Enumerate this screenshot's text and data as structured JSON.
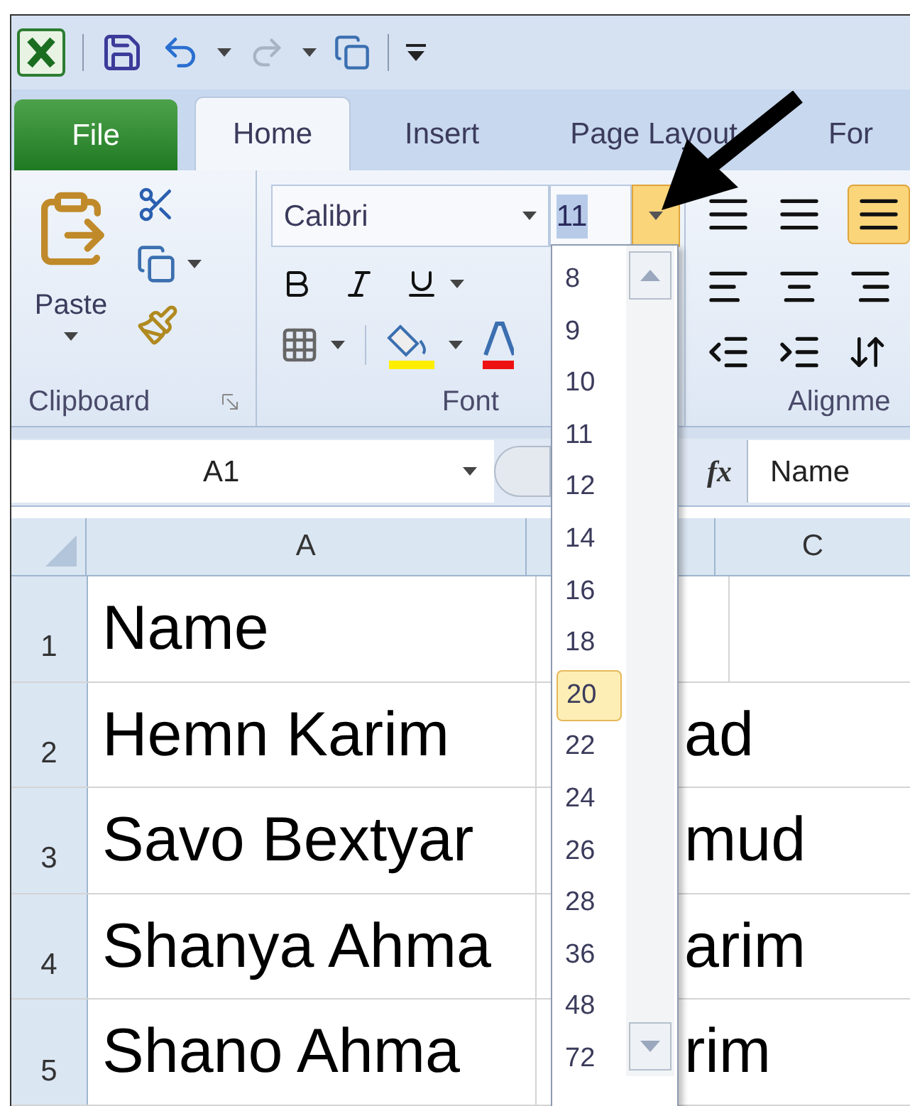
{
  "tabs": [
    {
      "label": "File",
      "kind": "file",
      "selected": false
    },
    {
      "label": "Home",
      "kind": "tab",
      "selected": true
    },
    {
      "label": "Insert",
      "kind": "tab",
      "selected": false
    },
    {
      "label": "Page Layout",
      "kind": "tab",
      "selected": false
    },
    {
      "label": "For",
      "kind": "tab",
      "selected": false
    }
  ],
  "clipboard_group": {
    "paste_label": "Paste",
    "label": "Clipboard"
  },
  "font_group": {
    "font_name": "Calibri",
    "font_size": "11",
    "label": "Font"
  },
  "alignment_group": {
    "label": "Alignme"
  },
  "name_box": "A1",
  "fx_label": "fx",
  "formula": "Name",
  "columns": [
    {
      "label": "A"
    },
    {
      "label": "C"
    }
  ],
  "rows": [
    {
      "number": "1",
      "left": "Name"
    },
    {
      "number": "2",
      "left": "Hemn Karim",
      "right": "ad"
    },
    {
      "number": "3",
      "left": "Savo Bextyar",
      "right": "mud"
    },
    {
      "number": "4",
      "left": "Shanya Ahma",
      "right": "arim"
    },
    {
      "number": "5",
      "left": "Shano Ahma",
      "right": "rim"
    }
  ],
  "font_size_menu": [
    {
      "label": "8",
      "selected": false
    },
    {
      "label": "9",
      "selected": false
    },
    {
      "label": "10",
      "selected": false
    },
    {
      "label": "11",
      "selected": false
    },
    {
      "label": "12",
      "selected": false
    },
    {
      "label": "14",
      "selected": false
    },
    {
      "label": "16",
      "selected": false
    },
    {
      "label": "18",
      "selected": false
    },
    {
      "label": "20",
      "selected": true
    },
    {
      "label": "22",
      "selected": false
    },
    {
      "label": "24",
      "selected": false
    },
    {
      "label": "26",
      "selected": false
    },
    {
      "label": "28",
      "selected": false
    },
    {
      "label": "36",
      "selected": false
    },
    {
      "label": "48",
      "selected": false
    },
    {
      "label": "72",
      "selected": false
    }
  ]
}
